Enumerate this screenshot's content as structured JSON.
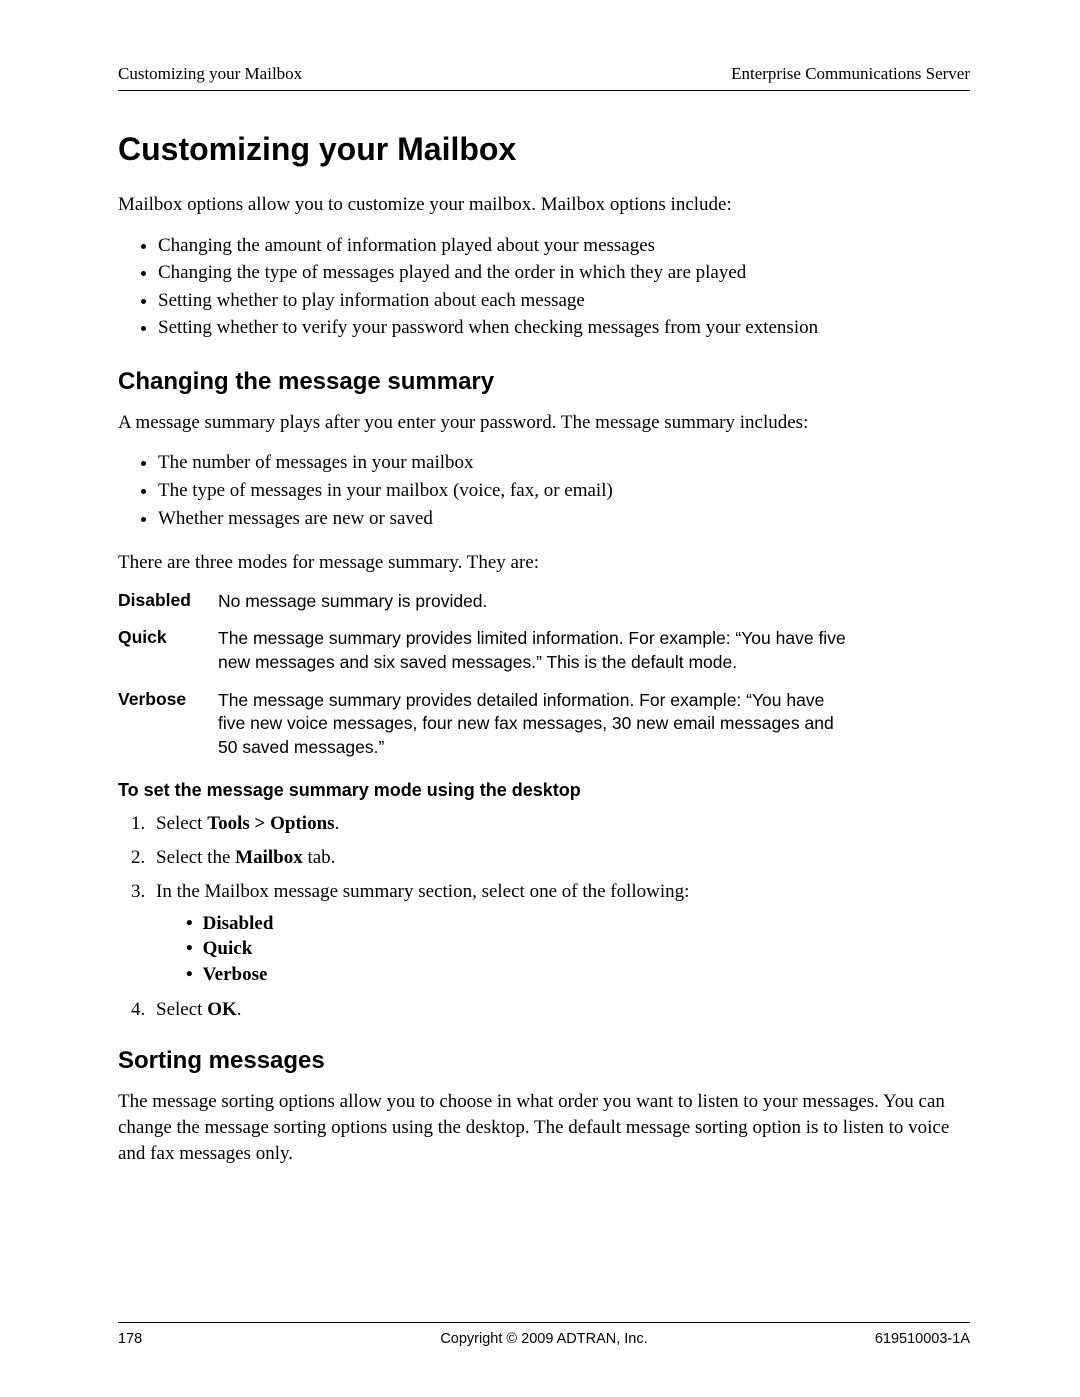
{
  "header": {
    "left": "Customizing your Mailbox",
    "right": "Enterprise Communications Server"
  },
  "title": "Customizing your Mailbox",
  "intro": "Mailbox options allow you to customize your mailbox. Mailbox options include:",
  "intro_bullets": [
    "Changing the amount of information played about your messages",
    "Changing the type of messages played and the order in which they are played",
    "Setting whether to play information about each message",
    "Setting whether to verify your password when checking messages from your extension"
  ],
  "section1": {
    "heading": "Changing the message summary",
    "para1": "A message summary plays after you enter your password. The message summary includes:",
    "bullets": [
      "The number of messages in your mailbox",
      "The type of messages in your mailbox (voice, fax, or email)",
      "Whether messages are new or saved"
    ],
    "para2": "There are three modes for message summary. They are:",
    "defs": [
      {
        "term": "Disabled",
        "def": "No message summary is provided."
      },
      {
        "term": "Quick",
        "def": "The message summary provides limited information. For example: “You have five new messages and six saved messages.” This is the default mode."
      },
      {
        "term": "Verbose",
        "def": "The message summary provides detailed information. For example: “You have five new voice messages, four new fax messages, 30 new email messages and 50 saved messages.”"
      }
    ],
    "subheading": "To set the message summary mode using the desktop",
    "steps": {
      "s1_pre": "Select ",
      "s1_bold": "Tools > Options",
      "s1_post": ".",
      "s2_pre": "Select the ",
      "s2_bold": "Mailbox",
      "s2_post": " tab.",
      "s3": "In the Mailbox message summary section, select one of the following:",
      "s3_items": [
        "Disabled",
        "Quick",
        "Verbose"
      ],
      "s4_pre": "Select ",
      "s4_bold": "OK",
      "s4_post": "."
    }
  },
  "section2": {
    "heading": "Sorting messages",
    "para": "The message sorting options allow you to choose in what order you want to listen to your messages. You can change the message sorting options using the desktop. The default message sorting option is to listen to voice and fax messages only."
  },
  "footer": {
    "left": "178",
    "center": "Copyright © 2009 ADTRAN, Inc.",
    "right": "619510003-1A"
  }
}
